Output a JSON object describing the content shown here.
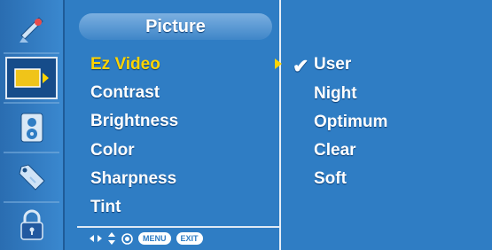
{
  "menu": {
    "title": "Picture",
    "items": [
      {
        "label": "Ez Video",
        "active": true
      },
      {
        "label": "Contrast"
      },
      {
        "label": "Brightness"
      },
      {
        "label": "Color"
      },
      {
        "label": "Sharpness"
      },
      {
        "label": "Tint"
      }
    ],
    "hints": {
      "menu_label": "MENU",
      "exit_label": "EXIT"
    }
  },
  "options": {
    "items": [
      {
        "label": "User",
        "checked": true
      },
      {
        "label": "Night"
      },
      {
        "label": "Optimum"
      },
      {
        "label": "Clear"
      },
      {
        "label": "Soft"
      }
    ]
  },
  "sidebar": {
    "icons": [
      "satellite-dish-icon",
      "picture-icon",
      "audio-icon",
      "tag-icon",
      "lock-icon"
    ],
    "selected_index": 1
  },
  "colors": {
    "background": "#2f7dc4",
    "active_text": "#ffd400",
    "text": "#ffffff"
  }
}
